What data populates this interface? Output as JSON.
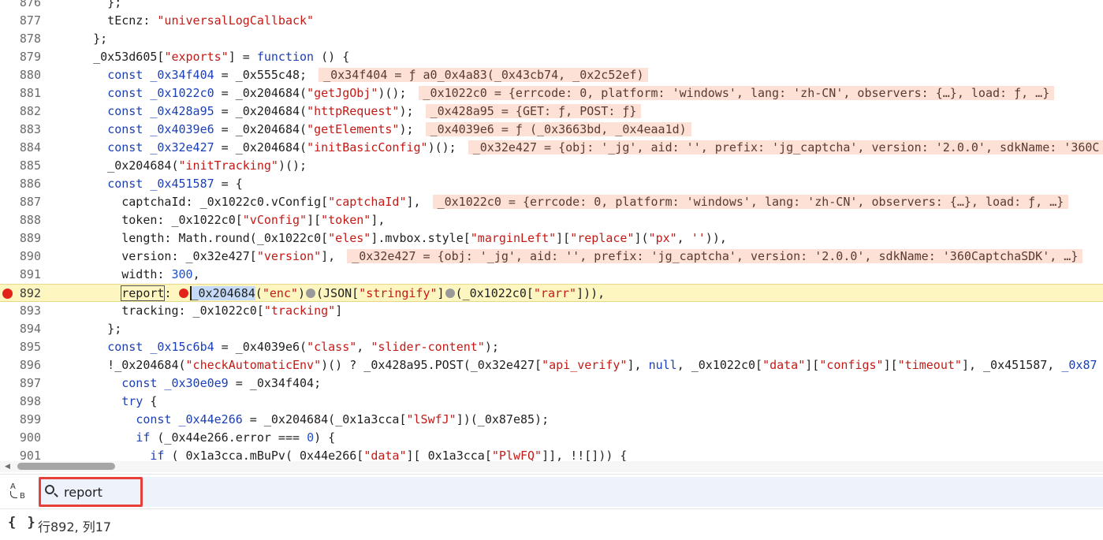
{
  "editor": {
    "lines": [
      {
        "n": "876",
        "segs": [
          [
            "p",
            "      };"
          ]
        ]
      },
      {
        "n": "877",
        "segs": [
          [
            "p",
            "      tEcnz: "
          ],
          [
            "s",
            "\"universalLogCallback\""
          ]
        ]
      },
      {
        "n": "878",
        "segs": [
          [
            "p",
            "    };"
          ]
        ]
      },
      {
        "n": "879",
        "segs": [
          [
            "p",
            "    _0x53d605["
          ],
          [
            "s",
            "\"exports\""
          ],
          [
            "p",
            "] = "
          ],
          [
            "k",
            "function"
          ],
          [
            "p",
            " () {"
          ]
        ]
      },
      {
        "n": "880",
        "segs": [
          [
            "p",
            "      "
          ],
          [
            "k",
            "const"
          ],
          [
            "p",
            " "
          ],
          [
            "k",
            "_0x34f404"
          ],
          [
            "p",
            " = _0x555c48; "
          ],
          [
            "h",
            "_0x34f404 = ƒ a0_0x4a83(_0x43cb74, _0x2c52ef)"
          ]
        ]
      },
      {
        "n": "881",
        "segs": [
          [
            "p",
            "      "
          ],
          [
            "k",
            "const"
          ],
          [
            "p",
            " "
          ],
          [
            "k",
            "_0x1022c0"
          ],
          [
            "p",
            " = _0x204684("
          ],
          [
            "s",
            "\"getJgObj\""
          ],
          [
            "p",
            ")(); "
          ],
          [
            "h",
            "_0x1022c0 = {errcode: 0, platform: 'windows', lang: 'zh-CN', observers: {…}, load: ƒ, …}"
          ]
        ]
      },
      {
        "n": "882",
        "segs": [
          [
            "p",
            "      "
          ],
          [
            "k",
            "const"
          ],
          [
            "p",
            " "
          ],
          [
            "k",
            "_0x428a95"
          ],
          [
            "p",
            " = _0x204684("
          ],
          [
            "s",
            "\"httpRequest\""
          ],
          [
            "p",
            "); "
          ],
          [
            "h",
            "_0x428a95 = {GET: ƒ, POST: ƒ}"
          ]
        ]
      },
      {
        "n": "883",
        "segs": [
          [
            "p",
            "      "
          ],
          [
            "k",
            "const"
          ],
          [
            "p",
            " "
          ],
          [
            "k",
            "_0x4039e6"
          ],
          [
            "p",
            " = _0x204684("
          ],
          [
            "s",
            "\"getElements\""
          ],
          [
            "p",
            "); "
          ],
          [
            "h",
            "_0x4039e6 = ƒ (_0x3663bd, _0x4eaa1d)"
          ]
        ]
      },
      {
        "n": "884",
        "segs": [
          [
            "p",
            "      "
          ],
          [
            "k",
            "const"
          ],
          [
            "p",
            " "
          ],
          [
            "k",
            "_0x32e427"
          ],
          [
            "p",
            " = _0x204684("
          ],
          [
            "s",
            "\"initBasicConfig\""
          ],
          [
            "p",
            ")(); "
          ],
          [
            "h",
            "_0x32e427 = {obj: '_jg', aid: '', prefix: 'jg_captcha', version: '2.0.0', sdkName: '360C"
          ]
        ]
      },
      {
        "n": "885",
        "segs": [
          [
            "p",
            "      _0x204684("
          ],
          [
            "s",
            "\"initTracking\""
          ],
          [
            "p",
            ")();"
          ]
        ]
      },
      {
        "n": "886",
        "segs": [
          [
            "p",
            "      "
          ],
          [
            "k",
            "const"
          ],
          [
            "p",
            " "
          ],
          [
            "k",
            "_0x451587"
          ],
          [
            "p",
            " = {"
          ]
        ]
      },
      {
        "n": "887",
        "segs": [
          [
            "p",
            "        captchaId: _0x1022c0.vConfig["
          ],
          [
            "s",
            "\"captchaId\""
          ],
          [
            "p",
            "], "
          ],
          [
            "h",
            "_0x1022c0 = {errcode: 0, platform: 'windows', lang: 'zh-CN', observers: {…}, load: ƒ, …}"
          ]
        ]
      },
      {
        "n": "888",
        "segs": [
          [
            "p",
            "        token: _0x1022c0["
          ],
          [
            "s",
            "\"vConfig\""
          ],
          [
            "p",
            "]["
          ],
          [
            "s",
            "\"token\""
          ],
          [
            "p",
            "],"
          ]
        ]
      },
      {
        "n": "889",
        "segs": [
          [
            "p",
            "        length: Math.round(_0x1022c0["
          ],
          [
            "s",
            "\"eles\""
          ],
          [
            "p",
            "].mvbox.style["
          ],
          [
            "s",
            "\"marginLeft\""
          ],
          [
            "p",
            "]["
          ],
          [
            "s",
            "\"replace\""
          ],
          [
            "p",
            "]("
          ],
          [
            "s",
            "\"px\""
          ],
          [
            "p",
            ", "
          ],
          [
            "s",
            "''"
          ],
          [
            "p",
            ")),"
          ]
        ]
      },
      {
        "n": "890",
        "segs": [
          [
            "p",
            "        version: _0x32e427["
          ],
          [
            "s",
            "\"version\""
          ],
          [
            "p",
            "], "
          ],
          [
            "h",
            "_0x32e427 = {obj: '_jg', aid: '', prefix: 'jg_captcha', version: '2.0.0', sdkName: '360CaptchaSDK', …}"
          ]
        ]
      },
      {
        "n": "891",
        "segs": [
          [
            "p",
            "        width: "
          ],
          [
            "n",
            "300"
          ],
          [
            "p",
            ","
          ]
        ]
      },
      {
        "n": "892",
        "paused": true,
        "segs": [
          [
            "p",
            "        "
          ],
          [
            "b",
            "report"
          ],
          [
            "p",
            ": "
          ],
          [
            "bp",
            ""
          ],
          [
            "sel",
            "_0x204684"
          ],
          [
            "p",
            "("
          ],
          [
            "s",
            "\"enc\""
          ],
          [
            "p",
            ")"
          ],
          [
            "g",
            ""
          ],
          [
            "p",
            "(JSON["
          ],
          [
            "s",
            "\"stringify\""
          ],
          [
            "p",
            "]"
          ],
          [
            "g",
            ""
          ],
          [
            "p",
            "(_0x1022c0["
          ],
          [
            "s",
            "\"rarr\""
          ],
          [
            "p",
            "])),"
          ]
        ]
      },
      {
        "n": "893",
        "segs": [
          [
            "p",
            "        tracking: _0x1022c0["
          ],
          [
            "s",
            "\"tracking\""
          ],
          [
            "p",
            "]"
          ]
        ]
      },
      {
        "n": "894",
        "segs": [
          [
            "p",
            "      };"
          ]
        ]
      },
      {
        "n": "895",
        "segs": [
          [
            "p",
            "      "
          ],
          [
            "k",
            "const"
          ],
          [
            "p",
            " "
          ],
          [
            "k",
            "_0x15c6b4"
          ],
          [
            "p",
            " = _0x4039e6("
          ],
          [
            "s",
            "\"class\""
          ],
          [
            "p",
            ", "
          ],
          [
            "s",
            "\"slider-content\""
          ],
          [
            "p",
            ");"
          ]
        ]
      },
      {
        "n": "896",
        "segs": [
          [
            "p",
            "      !_0x204684("
          ],
          [
            "s",
            "\"checkAutomaticEnv\""
          ],
          [
            "p",
            ")() ? _0x428a95.POST(_0x32e427["
          ],
          [
            "s",
            "\"api_verify\""
          ],
          [
            "p",
            "], "
          ],
          [
            "k",
            "null"
          ],
          [
            "p",
            ", _0x1022c0["
          ],
          [
            "s",
            "\"data\""
          ],
          [
            "p",
            "]["
          ],
          [
            "s",
            "\"configs\""
          ],
          [
            "p",
            "]["
          ],
          [
            "s",
            "\"timeout\""
          ],
          [
            "p",
            "], _0x451587, "
          ],
          [
            "k",
            "_0x87"
          ]
        ]
      },
      {
        "n": "897",
        "segs": [
          [
            "p",
            "        "
          ],
          [
            "k",
            "const"
          ],
          [
            "p",
            " "
          ],
          [
            "k",
            "_0x30e0e9"
          ],
          [
            "p",
            " = _0x34f404;"
          ]
        ]
      },
      {
        "n": "898",
        "segs": [
          [
            "p",
            "        "
          ],
          [
            "k",
            "try"
          ],
          [
            "p",
            " {"
          ]
        ]
      },
      {
        "n": "899",
        "segs": [
          [
            "p",
            "          "
          ],
          [
            "k",
            "const"
          ],
          [
            "p",
            " "
          ],
          [
            "k",
            "_0x44e266"
          ],
          [
            "p",
            " = _0x204684(_0x1a3cca["
          ],
          [
            "s",
            "\"lSwfJ\""
          ],
          [
            "p",
            "])(_0x87e85);"
          ]
        ]
      },
      {
        "n": "900",
        "segs": [
          [
            "p",
            "          "
          ],
          [
            "k",
            "if"
          ],
          [
            "p",
            " (_0x44e266.error === "
          ],
          [
            "n",
            "0"
          ],
          [
            "p",
            ") {"
          ]
        ]
      },
      {
        "n": "901",
        "segs": [
          [
            "p",
            "            "
          ],
          [
            "k",
            "if"
          ],
          [
            "p",
            " (_0x1a3cca.mBuPv(_0x44e266["
          ],
          [
            "s",
            "\"data\""
          ],
          [
            "p",
            "][_0x1a3cca["
          ],
          [
            "s",
            "\"PlwFQ\""
          ],
          [
            "p",
            "]], !![])) {"
          ]
        ]
      }
    ]
  },
  "search": {
    "value": "report",
    "case_icon_a": "A",
    "case_icon_b": "B"
  },
  "status": {
    "pretty_print": "{ }",
    "cursor_position": "行892, 列17"
  },
  "colors": {
    "keyword": "#1b3fb5",
    "string": "#c41a16",
    "breakpoint": "#e2231a",
    "paused_line": "#fdf6c0",
    "hint_bg": "#fde0d6",
    "search_highlight": "#e5403a"
  }
}
